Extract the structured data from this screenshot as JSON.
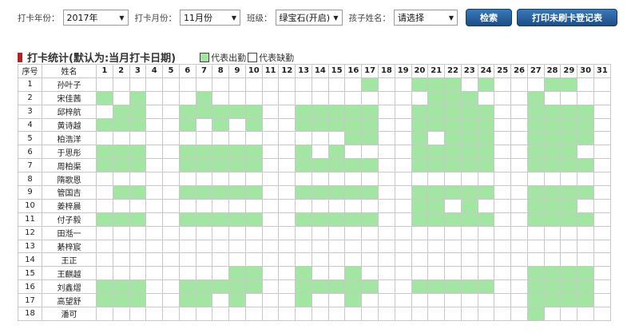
{
  "filters": {
    "year_label": "打卡年份：",
    "year_value": "2017年",
    "month_label": "打卡月份：",
    "month_value": "11月份",
    "class_label": "班级：",
    "class_value": "绿宝石(开启)",
    "child_label": "孩子姓名：",
    "child_value": "请选择"
  },
  "buttons": {
    "search": "检索",
    "print": "打印未刷卡登记表"
  },
  "section": {
    "title": "打卡统计(默认为:当月打卡日期)",
    "legend_present": "代表出勤",
    "legend_absent": "代表缺勤"
  },
  "colors": {
    "present": "#a3e6a3",
    "absent": "#ffffff",
    "title_marker": "#b22222",
    "button": "#1c4d86"
  },
  "table": {
    "seq_header": "序号",
    "name_header": "姓名",
    "days": [
      "1",
      "2",
      "3",
      "4",
      "5",
      "6",
      "7",
      "8",
      "9",
      "10",
      "11",
      "12",
      "13",
      "14",
      "15",
      "16",
      "17",
      "18",
      "19",
      "20",
      "21",
      "22",
      "23",
      "24",
      "25",
      "26",
      "27",
      "28",
      "29",
      "30",
      "31"
    ],
    "rows": [
      {
        "seq": "1",
        "name": "孙叶子",
        "present": [
          17,
          20,
          21,
          22,
          24,
          28,
          29
        ]
      },
      {
        "seq": "2",
        "name": "宋佳茜",
        "present": [
          1,
          3,
          7,
          21,
          22,
          23,
          27
        ]
      },
      {
        "seq": "3",
        "name": "邱梓航",
        "present": [
          2,
          3,
          6,
          7,
          8,
          9,
          10,
          13,
          14,
          15,
          16,
          17,
          20,
          21,
          22,
          23,
          24,
          27,
          28,
          29,
          30
        ]
      },
      {
        "seq": "4",
        "name": "黄诗越",
        "present": [
          1,
          2,
          3,
          6,
          8,
          10,
          13,
          14,
          15,
          16,
          17,
          20,
          21,
          22,
          23,
          24,
          27,
          28,
          29,
          30
        ]
      },
      {
        "seq": "5",
        "name": "柏浩洋",
        "present": [
          16,
          17,
          20,
          22,
          23,
          24,
          27,
          28,
          29,
          30
        ]
      },
      {
        "seq": "6",
        "name": "于思彤",
        "present": [
          1,
          2,
          3,
          6,
          7,
          8,
          9,
          10,
          13,
          15,
          20,
          21,
          22,
          23,
          24,
          27,
          28,
          29
        ]
      },
      {
        "seq": "7",
        "name": "周柏渠",
        "present": [
          1,
          2,
          3,
          6,
          7,
          8,
          9,
          10,
          13,
          14,
          15,
          16,
          17,
          20,
          21,
          22,
          23,
          24,
          27,
          28,
          29,
          30
        ]
      },
      {
        "seq": "8",
        "name": "隋歌恩",
        "present": []
      },
      {
        "seq": "9",
        "name": "管国吉",
        "present": [
          2,
          3,
          6,
          7,
          8,
          9,
          10,
          13,
          14,
          15,
          16,
          17,
          20,
          21,
          22,
          23,
          24,
          27,
          28,
          29,
          30
        ]
      },
      {
        "seq": "10",
        "name": "姜梓晨",
        "present": [
          20,
          21,
          23,
          27,
          28,
          29
        ]
      },
      {
        "seq": "11",
        "name": "付子毅",
        "present": [
          1,
          2,
          3,
          6,
          7,
          8,
          9,
          10,
          13,
          14,
          15,
          16,
          17,
          20,
          21,
          22,
          23,
          24,
          27,
          28,
          29,
          30
        ]
      },
      {
        "seq": "12",
        "name": "田湉一",
        "present": []
      },
      {
        "seq": "13",
        "name": "綦梓宸",
        "present": []
      },
      {
        "seq": "14",
        "name": "王正",
        "present": []
      },
      {
        "seq": "15",
        "name": "王麒越",
        "present": [
          9,
          10,
          13,
          16,
          27,
          28,
          29,
          30
        ]
      },
      {
        "seq": "16",
        "name": "刘鑫熠",
        "present": [
          1,
          2,
          3,
          6,
          7,
          8,
          9,
          10,
          13,
          14,
          15,
          16,
          17,
          20,
          21,
          22,
          23,
          24,
          27,
          28,
          29,
          30
        ]
      },
      {
        "seq": "17",
        "name": "高望舒",
        "present": [
          1,
          2,
          3,
          6,
          7,
          9,
          13,
          16,
          27,
          28,
          29,
          30
        ]
      },
      {
        "seq": "18",
        "name": "潘可",
        "present": [
          27
        ]
      }
    ]
  }
}
